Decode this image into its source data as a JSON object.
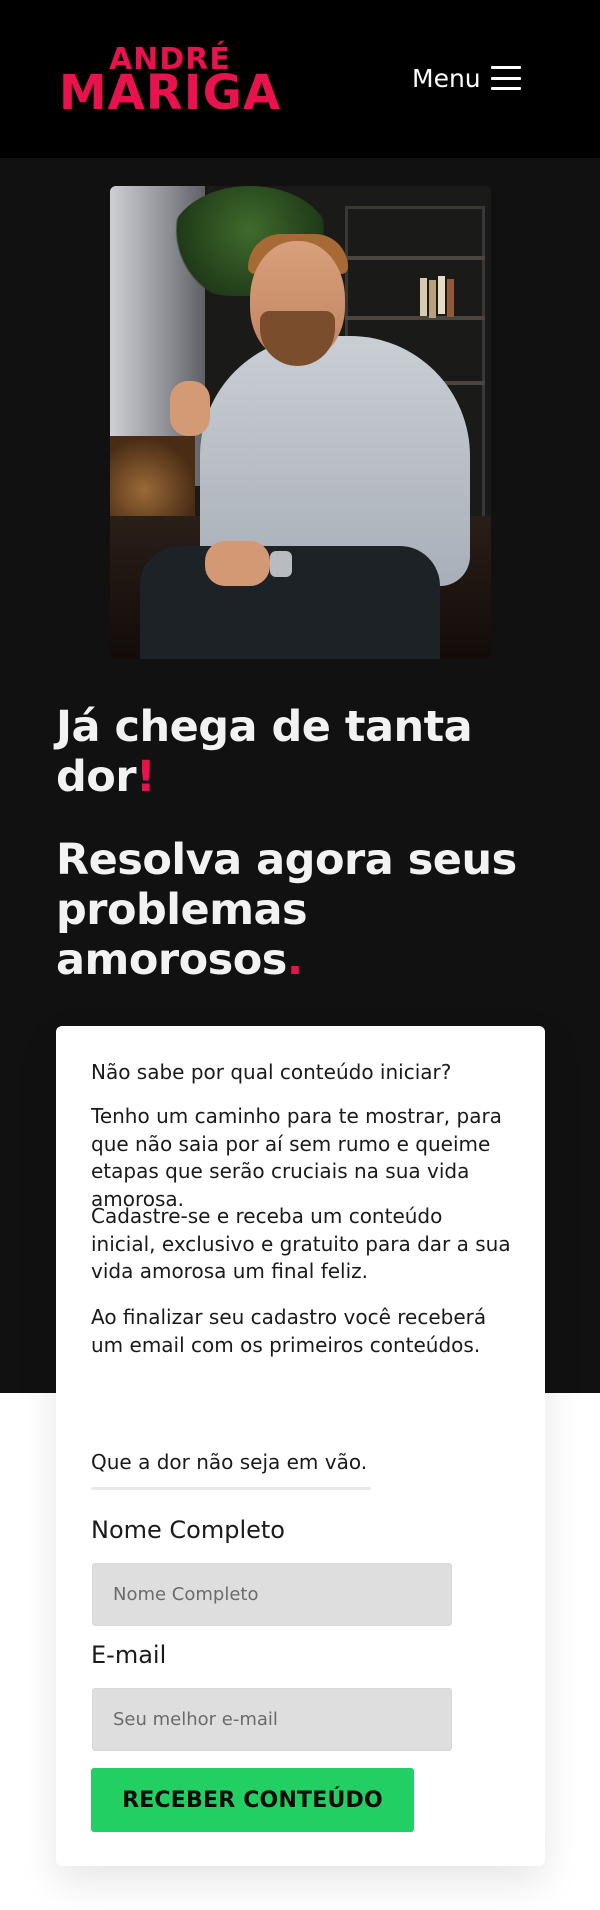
{
  "header": {
    "logo_line1": "ANDRÉ",
    "logo_line2": "MARIGA",
    "menu_label": "Menu",
    "menu_icon": "hamburger-menu-icon"
  },
  "colors": {
    "header_bg": "#000000",
    "hero_bg": "#111111",
    "accent": "#e8124d",
    "button_bg": "#22cf63",
    "input_bg": "#dedede"
  },
  "hero": {
    "photo": "portrait-man-thumbs-up",
    "heading1": "Já chega de tanta dor",
    "heading1_mark": "!",
    "heading2": "Resolva agora seus problemas amorosos",
    "heading2_mark": "."
  },
  "card": {
    "paragraphs": [
      "Não sabe por qual conteúdo iniciar?",
      "Tenho um caminho para te mostrar, para que não saia por aí sem rumo e queime etapas que serão cruciais na sua vida amorosa.",
      "Cadastre-se e receba um conteúdo inicial, exclusivo e gratuito para dar a sua vida amorosa um final feliz.",
      "Ao finalizar seu cadastro você receberá um email com os primeiros conteúdos.",
      "Que a dor não seja em vão."
    ],
    "form": {
      "name_label": "Nome Completo",
      "name_placeholder": "Nome Completo",
      "email_label": "E-mail",
      "email_placeholder": "Seu melhor e-mail",
      "submit_label": "RECEBER CONTEÚDO"
    }
  }
}
